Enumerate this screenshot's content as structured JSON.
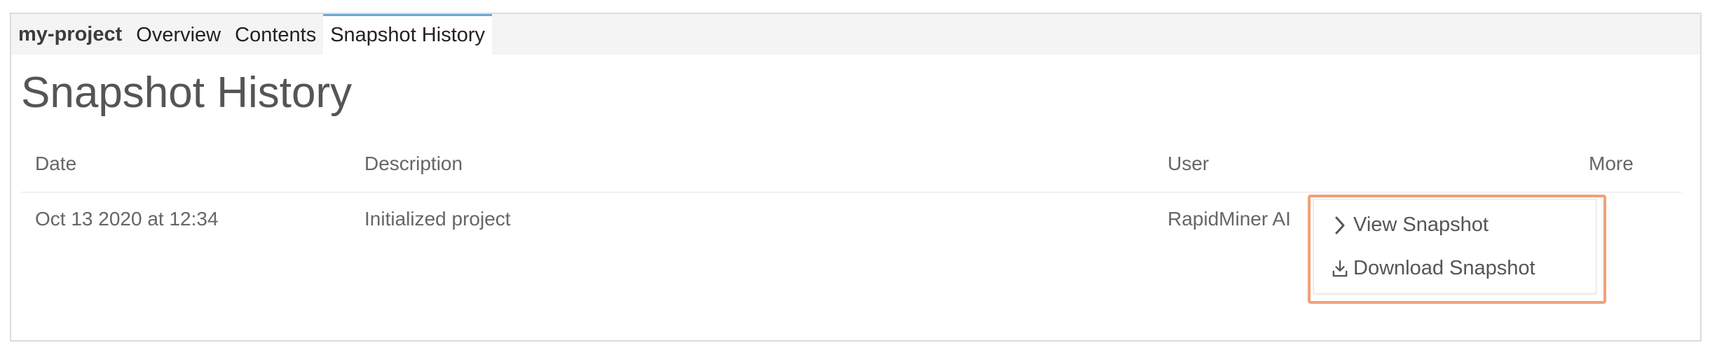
{
  "tabs": {
    "brand": "my-project",
    "items": [
      {
        "label": "Overview",
        "active": false
      },
      {
        "label": "Contents",
        "active": false
      },
      {
        "label": "Snapshot History",
        "active": true
      }
    ]
  },
  "page": {
    "title": "Snapshot History"
  },
  "table": {
    "headers": {
      "date": "Date",
      "description": "Description",
      "user": "User",
      "more": "More"
    },
    "rows": [
      {
        "date": "Oct 13 2020 at 12:34",
        "description": "Initialized project",
        "user": "RapidMiner AI"
      }
    ]
  },
  "menu": {
    "items": [
      {
        "label": "View Snapshot",
        "icon": "chevron-right-icon"
      },
      {
        "label": "Download Snapshot",
        "icon": "download-icon"
      }
    ]
  },
  "colors": {
    "active_tab_accent": "#6aa8d6",
    "highlight": "#f0a27a"
  }
}
